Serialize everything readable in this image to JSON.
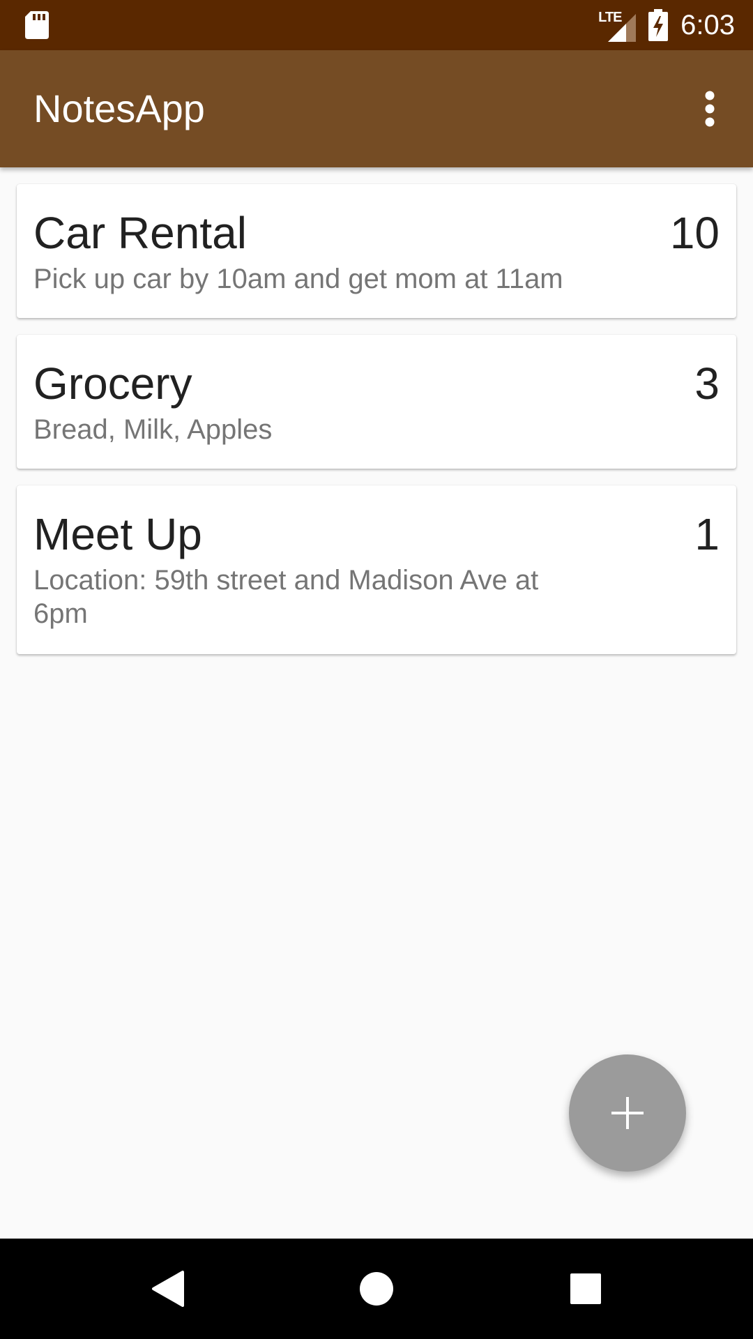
{
  "status_bar": {
    "network": "LTE",
    "time": "6:03"
  },
  "app_bar": {
    "title": "NotesApp",
    "overflow_icon": "more-vert-icon"
  },
  "notes": [
    {
      "title": "Car Rental",
      "count": "10",
      "body": "Pick up car by 10am and get mom at 11am"
    },
    {
      "title": "Grocery",
      "count": "3",
      "body": "Bread, Milk, Apples"
    },
    {
      "title": "Meet Up",
      "count": "1",
      "body": "Location: 59th street and Madison Ave at 6pm"
    }
  ],
  "fab": {
    "icon": "plus-icon"
  },
  "nav_bar": {
    "back_icon": "back-icon",
    "home_icon": "home-icon",
    "recents_icon": "recents-icon"
  },
  "colors": {
    "status_bar": "#5a2800",
    "app_bar": "#754c24",
    "background": "#fafafa",
    "fab": "#9b9b9b"
  }
}
